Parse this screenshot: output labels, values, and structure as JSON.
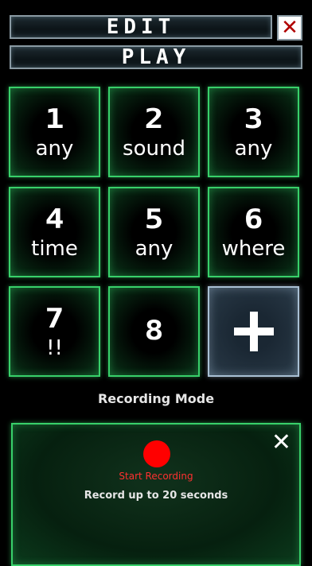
{
  "header": {
    "edit_label": "EDIT",
    "play_label": "PLAY",
    "close_label": "✕"
  },
  "pads": [
    {
      "number": "1",
      "label": "any"
    },
    {
      "number": "2",
      "label": "sound"
    },
    {
      "number": "3",
      "label": "any"
    },
    {
      "number": "4",
      "label": "time"
    },
    {
      "number": "5",
      "label": "any"
    },
    {
      "number": "6",
      "label": "where"
    },
    {
      "number": "7",
      "label": "!!"
    },
    {
      "number": "8",
      "label": ""
    }
  ],
  "add_pad": {
    "icon": "plus-icon"
  },
  "recording": {
    "mode_title": "Recording Mode",
    "start_label": "Start Recording",
    "hint": "Record up to 20 seconds",
    "close_label": "✕"
  },
  "colors": {
    "accent_green": "#38d06a",
    "record_red": "#ff0000"
  }
}
